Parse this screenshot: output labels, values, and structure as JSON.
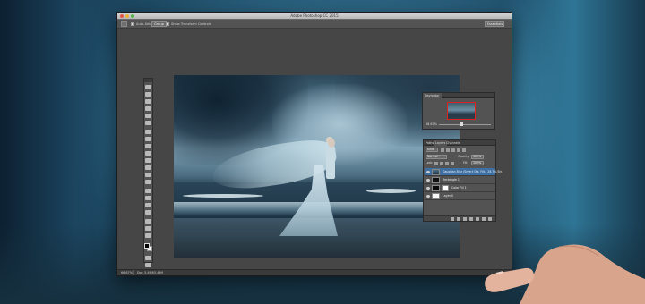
{
  "app": {
    "window_title": "Adobe Photoshop CC 2015"
  },
  "options_bar": {
    "auto_select_label": "Auto-Select:",
    "auto_select_value": "Group",
    "show_transform_label": "Show Transform Controls",
    "workspace_value": "Essentials"
  },
  "navigator": {
    "tabs": [
      "Navigator"
    ],
    "zoom": "66.67%"
  },
  "layers_panel": {
    "tabs": [
      "Paths",
      "Layers",
      "Channels"
    ],
    "kind_filter": "Kind",
    "blend_mode": "Normal",
    "opacity_label": "Opacity:",
    "opacity_value": "100%",
    "lock_label": "Lock:",
    "fill_label": "Fill:",
    "fill_value": "100%",
    "layers": [
      {
        "name": "Gaussian Blur (Smart Obj. Filt.) 28.7% Str.",
        "selected": true
      },
      {
        "name": "Rectangle 1",
        "selected": false
      },
      {
        "name": "Color Fill 1",
        "selected": false
      },
      {
        "name": "Layer 0",
        "selected": false
      }
    ]
  },
  "status_bar": {
    "zoom": "66.67%",
    "doc_info": "Doc: 5.49M/5.49M"
  },
  "colors": {
    "selected_layer": "#3e6fa3",
    "workspace_bg": "#464646",
    "panel_bg": "#535353",
    "foreground_color": "#000000",
    "background_color": "#ffffff"
  }
}
